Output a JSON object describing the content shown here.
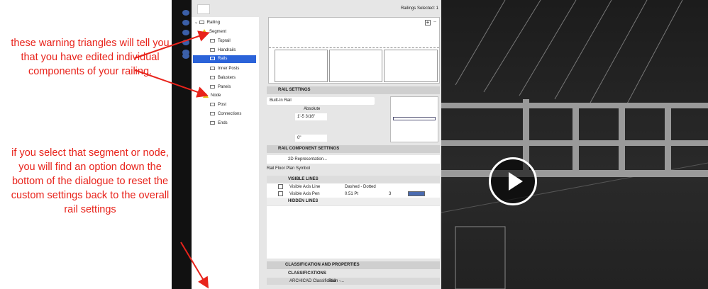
{
  "annotations": {
    "note1": "these warning triangles will tell you that you have edited individual components of your railing.",
    "note2": "if you select that segment or node, you will find an option down the bottom of the dialogue to reset the custom settings back to the overall rail settings"
  },
  "dialog": {
    "selected_count": "Railings Selected: 1",
    "tree": [
      {
        "label": "Railing"
      },
      {
        "label": "Segment"
      },
      {
        "label": "Toprail"
      },
      {
        "label": "Handrails"
      },
      {
        "label": "Rails"
      },
      {
        "label": "Inner Posts"
      },
      {
        "label": "Balusters"
      },
      {
        "label": "Panels"
      },
      {
        "label": "Node"
      },
      {
        "label": "Post"
      },
      {
        "label": "Connections"
      },
      {
        "label": "Ends"
      }
    ],
    "rail_settings": {
      "title": "RAIL SETTINGS",
      "type": "Built-In Rail",
      "mode": "Absolute",
      "height": "1'-5 3/16\"",
      "offset": "0\""
    },
    "component": {
      "title": "RAIL COMPONENT SETTINGS",
      "representation": "2D Representation...",
      "symbol_label": "Rail Floor Plan Symbol",
      "visible_lines": "VISIBLE LINES",
      "rows": [
        {
          "name": "Visible Axis Line",
          "value": "Dashed - Dotted",
          "extra": ""
        },
        {
          "name": "Visible Axis Pen",
          "value": "0.51 Pt",
          "extra": "3"
        }
      ],
      "hidden_lines": "HIDDEN LINES"
    },
    "classification": {
      "title": "CLASSIFICATION AND PROPERTIES",
      "sub": "CLASSIFICATIONS",
      "row_name": "ARCHICAD Classification -...",
      "row_value": "Rail"
    }
  },
  "accent": "#2b63d9",
  "annotation_color": "#e8231b"
}
